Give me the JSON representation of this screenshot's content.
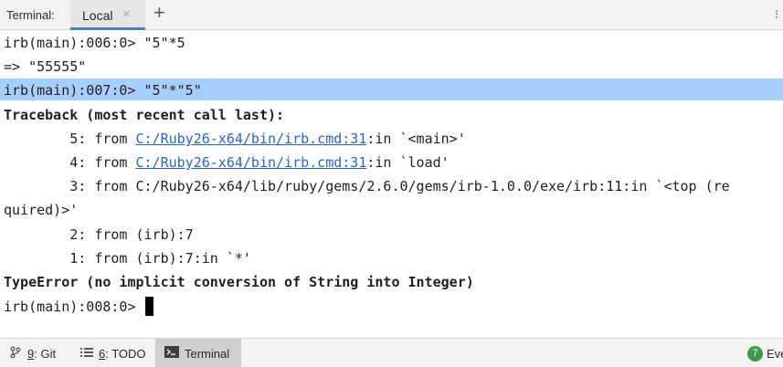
{
  "tabbar": {
    "label": "Terminal:",
    "active_tab": "Local",
    "close_glyph": "×",
    "new_tab_glyph": "+",
    "settings_glyph": "⁝"
  },
  "terminal": {
    "l1": "irb(main):006:0> \"5\"*5",
    "l2": "=> \"55555\"",
    "l3": "irb(main):007:0> \"5\"*\"5\"",
    "l4": "Traceback (most recent call last):",
    "l5_prefix": "        5: from ",
    "l5_link": "C:/Ruby26-x64/bin/irb.cmd:31",
    "l5_suffix": ":in `<main>'",
    "l6_prefix": "        4: from ",
    "l6_link": "C:/Ruby26-x64/bin/irb.cmd:31",
    "l6_suffix": ":in `load'",
    "l7": "        3: from C:/Ruby26-x64/lib/ruby/gems/2.6.0/gems/irb-1.0.0/exe/irb:11:in `<top (re",
    "l8": "quired)>'",
    "l9": "        2: from (irb):7",
    "l10": "        1: from (irb):7:in `*'",
    "l11": "TypeError (no implicit conversion of String into Integer)",
    "l12": "irb(main):008:0> "
  },
  "bottombar": {
    "git_icon": "git-branch",
    "git_num": "9",
    "git_label": ": Git",
    "todo_icon": "list",
    "todo_num": "6",
    "todo_label": ": TODO",
    "terminal_icon": "terminal",
    "terminal_label": "Terminal",
    "events_count": "7",
    "events_label": "Eve"
  },
  "colors": {
    "accent": "#4083c9",
    "highlight": "#a6cfff",
    "link": "#2a64c8",
    "events_badge": "#3b9a4b"
  }
}
